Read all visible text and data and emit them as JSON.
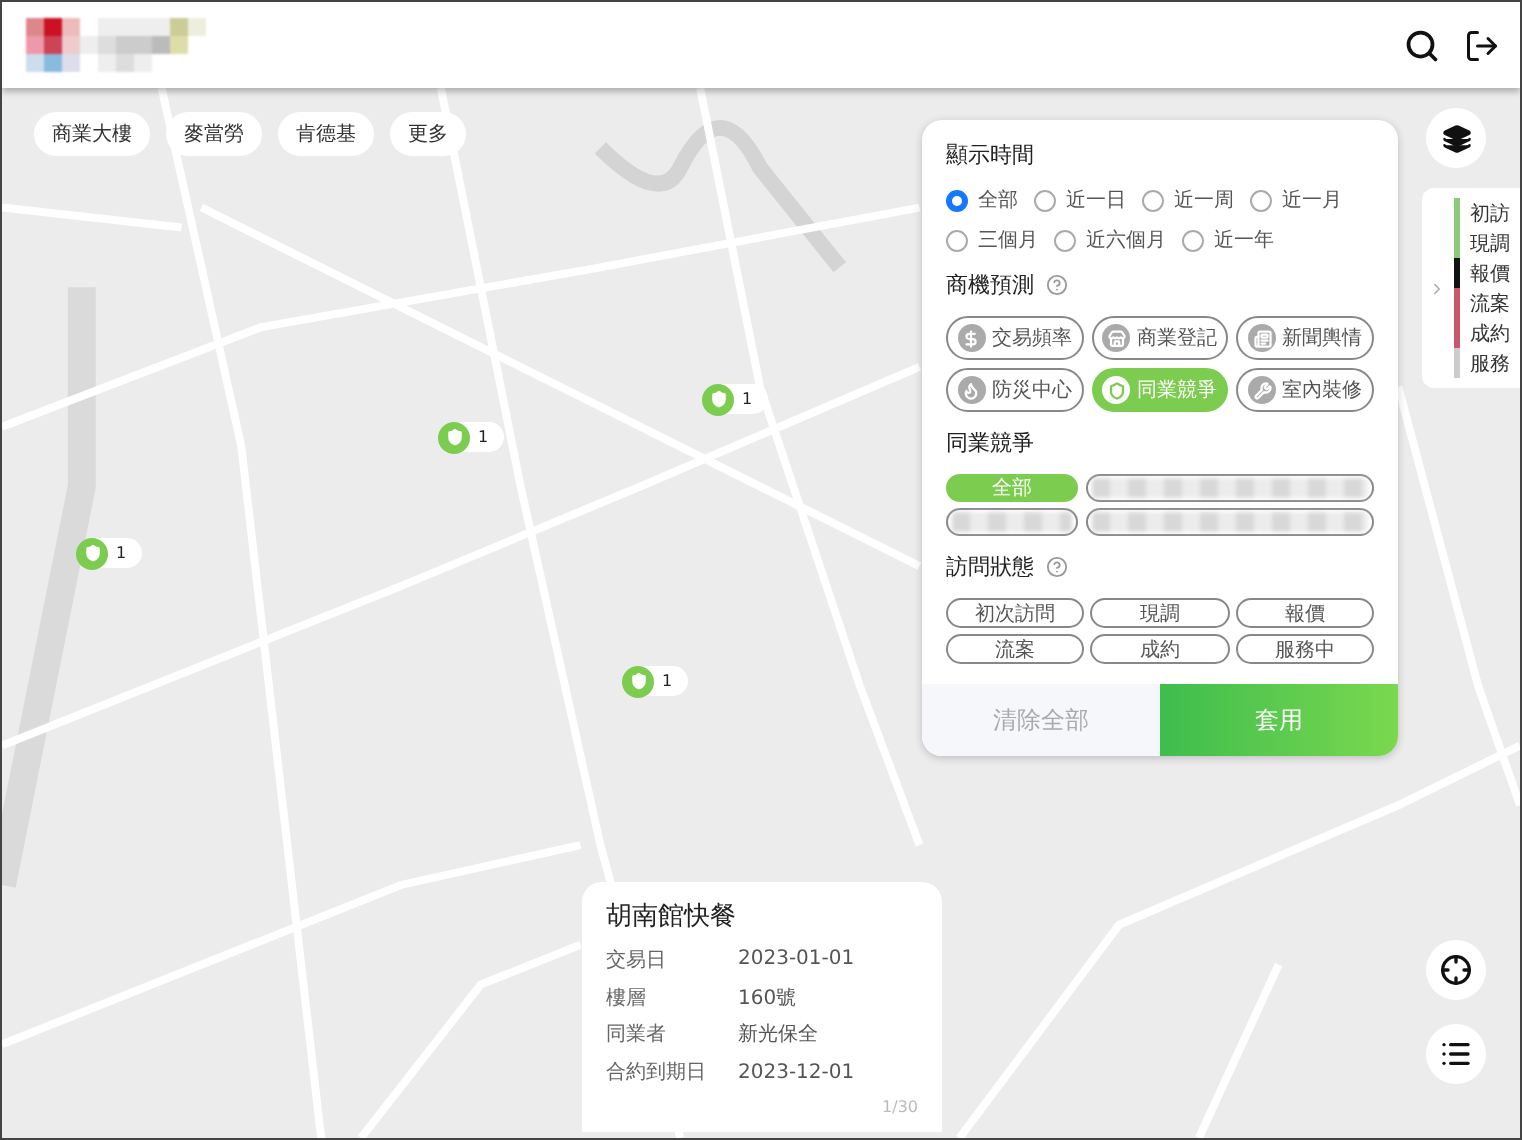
{
  "quick_filters": [
    "商業大樓",
    "麥當勞",
    "肯德基",
    "更多"
  ],
  "filter_panel": {
    "time": {
      "title": "顯示時間",
      "options": [
        {
          "label": "全部",
          "selected": true
        },
        {
          "label": "近一日",
          "selected": false
        },
        {
          "label": "近一周",
          "selected": false
        },
        {
          "label": "近一月",
          "selected": false
        },
        {
          "label": "三個月",
          "selected": false
        },
        {
          "label": "近六個月",
          "selected": false
        },
        {
          "label": "近一年",
          "selected": false
        }
      ]
    },
    "prediction": {
      "title": "商機預測",
      "chips": [
        {
          "label": "交易頻率",
          "kind": "dollar",
          "selected": false
        },
        {
          "label": "商業登記",
          "kind": "store",
          "selected": false
        },
        {
          "label": "新聞輿情",
          "kind": "news",
          "selected": false
        },
        {
          "label": "防災中心",
          "kind": "fire",
          "selected": false
        },
        {
          "label": "同業競爭",
          "kind": "shield",
          "selected": true
        },
        {
          "label": "室內裝修",
          "kind": "tool",
          "selected": false
        }
      ]
    },
    "competitors": {
      "title": "同業競爭",
      "chips": [
        {
          "kind": "text",
          "label": "全部",
          "selected": true
        },
        {
          "kind": "blurred",
          "selected": false
        },
        {
          "kind": "blurred",
          "selected": false
        },
        {
          "kind": "blurred",
          "selected": false
        }
      ]
    },
    "visit_status": {
      "title": "訪問狀態",
      "chips": [
        {
          "label": "初次訪問",
          "selected": false
        },
        {
          "label": "現調",
          "selected": false
        },
        {
          "label": "報價",
          "selected": false
        },
        {
          "label": "流案",
          "selected": false
        },
        {
          "label": "成約",
          "selected": false
        },
        {
          "label": "服務中",
          "selected": false
        }
      ]
    },
    "actions": {
      "clear": "清除全部",
      "apply": "套用"
    }
  },
  "legend": [
    {
      "label": "初訪",
      "color": "#8cc97a"
    },
    {
      "label": "現調",
      "color": "#8cc97a"
    },
    {
      "label": "報價",
      "color": "#111111"
    },
    {
      "label": "流案",
      "color": "#c9566a"
    },
    {
      "label": "成約",
      "color": "#c9566a"
    },
    {
      "label": "服務",
      "color": "#cccccc"
    }
  ],
  "markers": [
    {
      "count": "1"
    },
    {
      "count": "1"
    },
    {
      "count": "1"
    },
    {
      "count": "1"
    }
  ],
  "info_card": {
    "title": "胡南館快餐",
    "fields": [
      {
        "label": "交易日",
        "value": "2023-01-01"
      },
      {
        "label": "樓層",
        "value": "160號"
      },
      {
        "label": "同業者",
        "value": "新光保全"
      },
      {
        "label": "合約到期日",
        "value": "2023-12-01"
      }
    ],
    "page": "1/30"
  }
}
